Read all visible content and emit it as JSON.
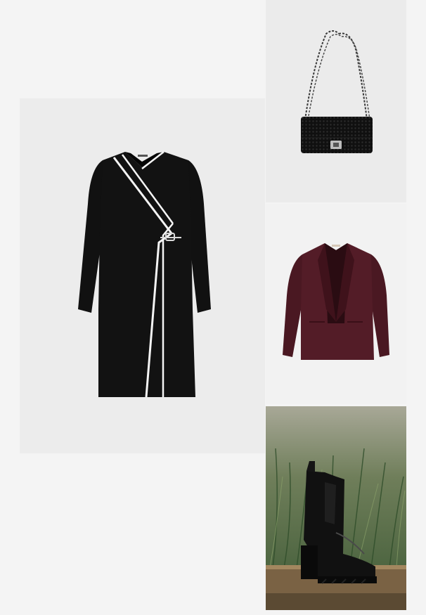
{
  "products": [
    {
      "id": "dress",
      "icon": "wrap-dress",
      "color": "#121212"
    },
    {
      "id": "bag",
      "icon": "chain-shoulder-bag",
      "color": "#101010"
    },
    {
      "id": "blazer",
      "icon": "shawl-collar-blazer",
      "color": "#4d1a24"
    },
    {
      "id": "boot",
      "icon": "chelsea-boot",
      "color": "#111111"
    }
  ],
  "colors": {
    "page_background": "#f4f4f4",
    "dress_tile_bg": "#ececec",
    "bag_tile_bg": "#ebebeb",
    "blazer_tile_bg": "#f2f2f2",
    "piping": "#f5f5f5"
  }
}
